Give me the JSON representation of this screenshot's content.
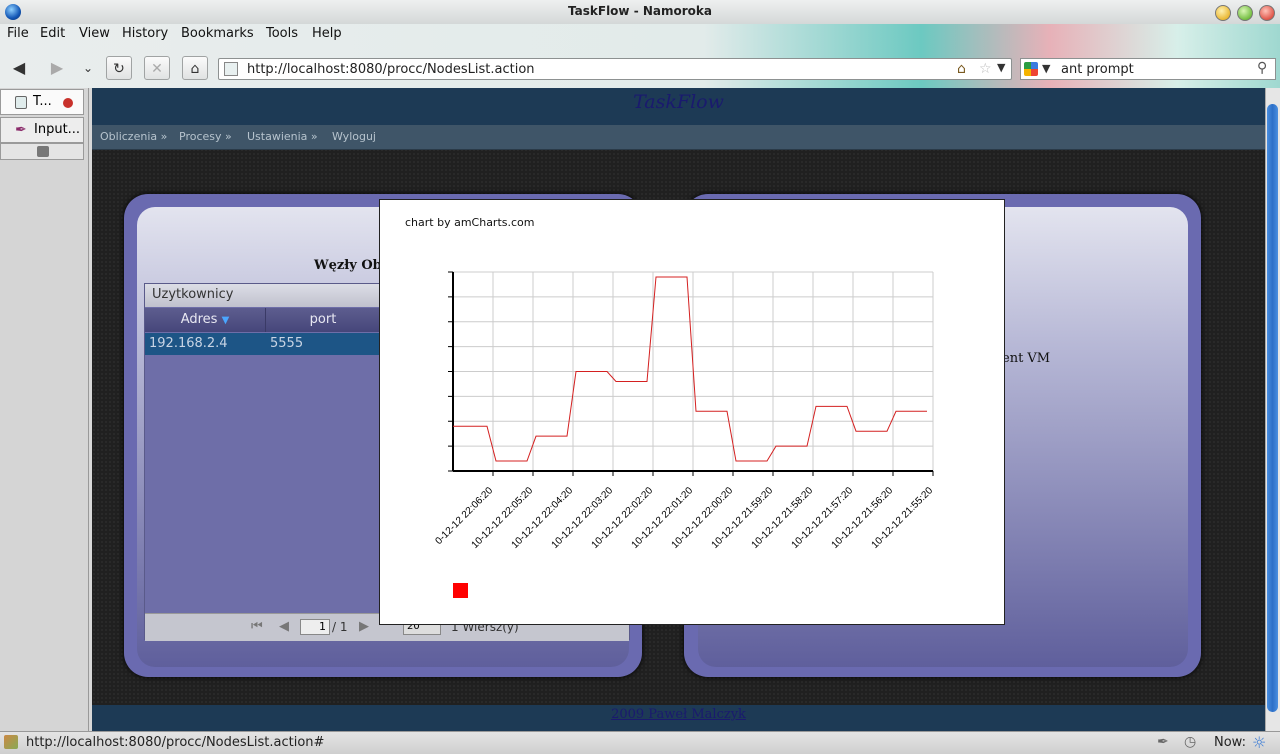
{
  "window": {
    "title": "TaskFlow - Namoroka"
  },
  "menu": {
    "items": [
      "File",
      "Edit",
      "View",
      "History",
      "Bookmarks",
      "Tools",
      "Help"
    ]
  },
  "navbar": {
    "back_icon": "back-arrow-icon",
    "forward_icon": "forward-arrow-icon",
    "url": "http://localhost:8080/procc/NodesList.action",
    "search_value": "ant prompt"
  },
  "sidebar": {
    "tabs": [
      "T...",
      "Input..."
    ]
  },
  "site": {
    "title": "TaskFlow",
    "nav": [
      "Obliczenia »",
      "Procesy »",
      "Ustawienia »",
      "Wyloguj"
    ],
    "footer": "2009 Paweł Malczyk"
  },
  "left_panel": {
    "heading": "Węzły Ob",
    "grid": {
      "title": "Uzytkownicy",
      "columns": [
        "Adres",
        "port"
      ],
      "rows": [
        [
          "192.168.2.4",
          "5555"
        ]
      ],
      "pager": {
        "page": "1",
        "of": "/ 1",
        "page_size": "20",
        "summary": "1 Wiersz(y)"
      }
    }
  },
  "right_panel": {
    "text": "ent VM"
  },
  "chart_credit": "chart by amCharts.com",
  "chart_data": {
    "type": "line",
    "color": "#d42020",
    "x": [
      "10-12-12 22:06:20",
      "10-12-12 22:05:20",
      "10-12-12 22:04:20",
      "10-12-12 22:03:20",
      "10-12-12 22:02:20",
      "10-12-12 22:01:20",
      "10-12-12 22:00:20",
      "10-12-12 21:59:20",
      "10-12-12 21:58:20",
      "10-12-12 21:57:20",
      "10-12-12 21:56:20",
      "10-12-12 21:55:20"
    ],
    "x_labels": [
      "0-12-12 22:06:20",
      "10-12-12 22:05:20",
      "10-12-12 22:04:20",
      "10-12-12 22:03:20",
      "10-12-12 22:02:20",
      "10-12-12 22:01:20",
      "10-12-12 22:00:20",
      "10-12-12 21:59:20",
      "10-12-12 21:58:20",
      "10-12-12 21:57:20",
      "10-12-12 21:56:20",
      "10-12-12 21:55:20"
    ],
    "values": [
      1.8,
      0.4,
      1.4,
      4.0,
      3.6,
      7.8,
      2.4,
      0.4,
      1.0,
      2.6,
      1.6,
      2.4
    ],
    "ylim": [
      0,
      8
    ],
    "grid": true,
    "legend": "bottom-left"
  },
  "status": {
    "url": "http://localhost:8080/procc/NodesList.action#",
    "now_label": "Now:"
  }
}
